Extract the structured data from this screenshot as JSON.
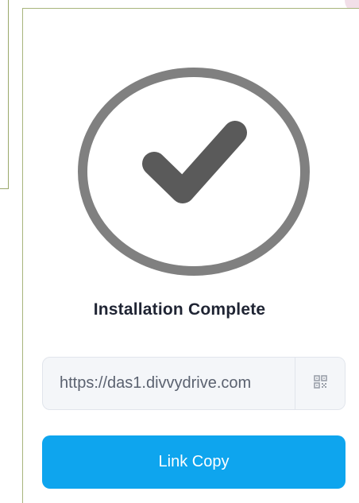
{
  "dialog": {
    "title": "Installation Complete",
    "status_icon": "check-circle-icon"
  },
  "link": {
    "value": "https://das1.divvydrive.com",
    "qr_icon": "qr-code-icon"
  },
  "actions": {
    "copy_label": "Link Copy"
  },
  "colors": {
    "accent": "#0ea5ee",
    "check": "#5a5a5a",
    "ring": "#808080"
  }
}
